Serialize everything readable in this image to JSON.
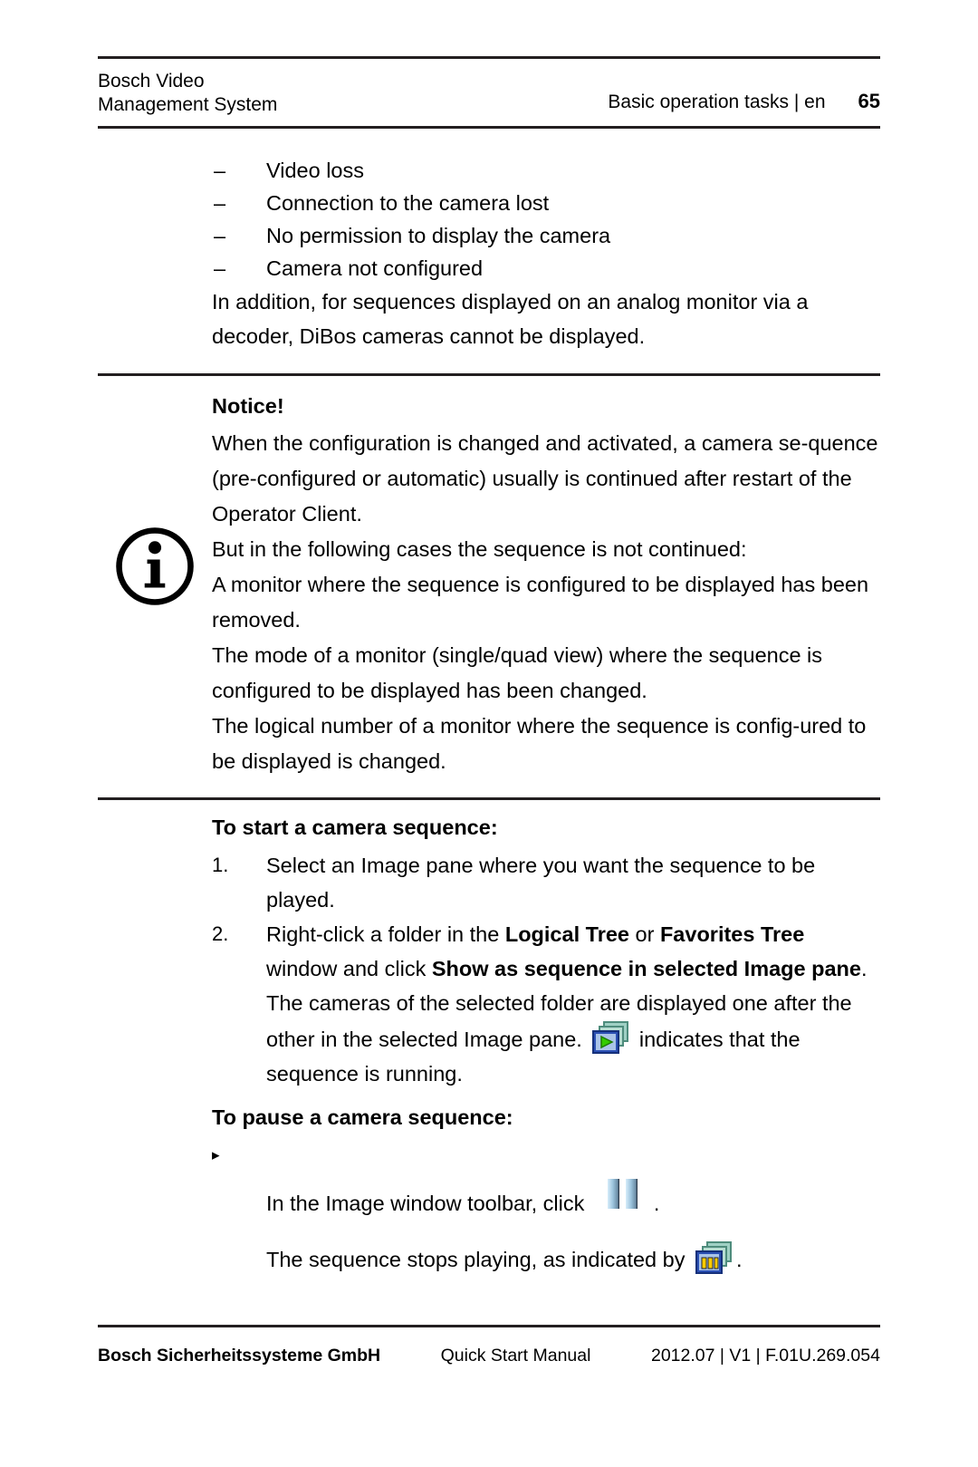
{
  "header": {
    "product": "Bosch Video\nManagement System",
    "section": "Basic operation tasks | en",
    "page_number": "65"
  },
  "intro": {
    "dash_items": [
      "Video loss",
      "Connection to the camera lost",
      "No permission to display the camera",
      "Camera not configured"
    ],
    "dash_marker": "–",
    "paragraph": "In addition, for sequences displayed on an analog monitor via a decoder, DiBos cameras cannot be displayed."
  },
  "notice": {
    "icon_name": "info-icon",
    "icon_glyph": "i",
    "title": "Notice!",
    "lines": [
      "When the configuration is changed and activated, a camera se-quence (pre-configured or automatic) usually is continued after restart of the Operator Client.",
      "But in the following cases the sequence is not continued:",
      "A monitor where the sequence is configured to be displayed has been removed.",
      "The mode of a monitor (single/quad view) where the sequence is configured to be displayed has been changed.",
      "The logical number of a monitor where the sequence is config-ured to be displayed is changed."
    ]
  },
  "start_procedure": {
    "title": "To start a camera sequence:",
    "steps": [
      {
        "number": "1.",
        "text_1": "Select an Image pane where you want the sequence to be played."
      },
      {
        "number": "2.",
        "text_1": "Right-click a folder in the ",
        "bold_1": "Logical Tree",
        "text_2": " or ",
        "bold_2": "Favorites Tree",
        "text_3": " window and click ",
        "bold_3": "Show as sequence in selected Image pane",
        "text_4": ".",
        "follow_1": "The cameras of the selected folder are displayed one after the other in the selected Image pane. ",
        "icon_name": "sequence-playing-icon",
        "follow_2": " indicates that the sequence is running."
      }
    ]
  },
  "pause_procedure": {
    "title": "To pause a camera sequence:",
    "marker": "▸",
    "step_text_1": "In the Image window toolbar, click ",
    "pause_icon_name": "pause-icon",
    "step_text_2": ".",
    "result_text_1": "The sequence stops playing, as indicated by ",
    "stopped_icon_name": "sequence-stopped-icon",
    "result_text_2": "."
  },
  "footer": {
    "company": "Bosch Sicherheitssysteme GmbH",
    "manual": "Quick Start Manual",
    "version": "2012.07 | V1 | F.01U.269.054"
  },
  "colors": {
    "rule": "#231f20",
    "text": "#000000",
    "icon_green": "#33cc00",
    "icon_blue": "#2b50b4",
    "icon_teal": "#88bfb4",
    "icon_yellow": "#ffcc00"
  }
}
